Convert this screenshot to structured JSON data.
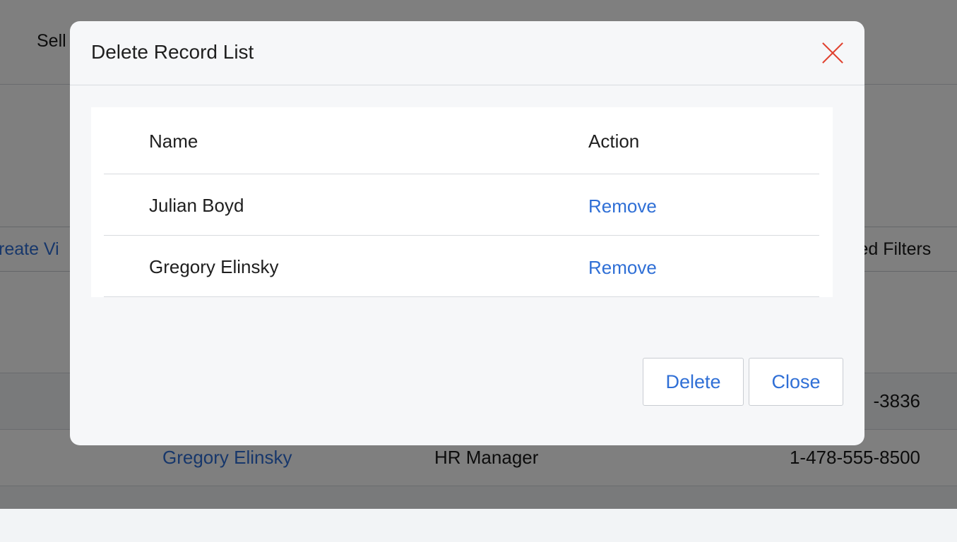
{
  "background": {
    "header_title": "Sell",
    "create_view_label": "reate Vi",
    "saved_filters_label": "ved Filters",
    "rows": [
      {
        "name": "",
        "title": "",
        "phone": "-3836"
      },
      {
        "name": "Gregory Elinsky",
        "title": "HR Manager",
        "phone": "1-478-555-8500"
      },
      {
        "name": "",
        "title": "",
        "phone": ""
      }
    ]
  },
  "modal": {
    "title": "Delete Record List",
    "table": {
      "columns": [
        "Name",
        "Action"
      ],
      "rows": [
        {
          "name": "Julian Boyd",
          "action": "Remove"
        },
        {
          "name": "Gregory Elinsky",
          "action": "Remove"
        }
      ]
    },
    "buttons": {
      "delete": "Delete",
      "close": "Close"
    },
    "close_icon": "close-icon"
  },
  "colors": {
    "link": "#2f6fd6",
    "close_x": "#e0412f",
    "overlay": "rgba(0,0,0,0.5)"
  }
}
